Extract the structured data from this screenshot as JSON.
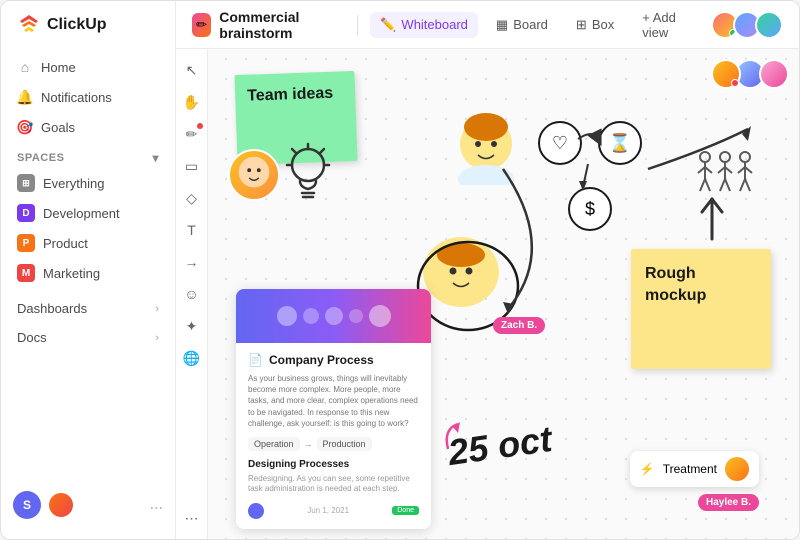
{
  "app": {
    "logo_text": "ClickUp"
  },
  "sidebar": {
    "nav": [
      {
        "id": "home",
        "label": "Home",
        "icon": "⌂"
      },
      {
        "id": "notifications",
        "label": "Notifications",
        "icon": "🔔"
      },
      {
        "id": "goals",
        "label": "Goals",
        "icon": "🎯"
      }
    ],
    "spaces_label": "Spaces",
    "spaces": [
      {
        "id": "everything",
        "label": "Everything",
        "badge": "⊞",
        "color": "#888"
      },
      {
        "id": "development",
        "label": "Development",
        "badge": "D",
        "color": "#7c3aed"
      },
      {
        "id": "product",
        "label": "Product",
        "badge": "P",
        "color": "#f97316"
      },
      {
        "id": "marketing",
        "label": "Marketing",
        "badge": "M",
        "color": "#ef4444"
      }
    ],
    "sections": [
      {
        "id": "dashboards",
        "label": "Dashboards"
      },
      {
        "id": "docs",
        "label": "Docs"
      }
    ],
    "footer": {
      "user_initial": "S",
      "dots": "..."
    }
  },
  "topbar": {
    "breadcrumb_title": "Commercial brainstorm",
    "views": [
      {
        "id": "whiteboard",
        "label": "Whiteboard",
        "icon": "✏️",
        "active": true
      },
      {
        "id": "board",
        "label": "Board",
        "icon": "▦"
      },
      {
        "id": "box",
        "label": "Box",
        "icon": "⊞"
      }
    ],
    "add_view_label": "+ Add view"
  },
  "canvas": {
    "sticky_green_text": "Team ideas",
    "sticky_yellow_text": "Rough mockup",
    "date_label": "25 oct",
    "process_card": {
      "title": "Company Process",
      "desc": "As your business grows, things will inevitably become more complex. More people, more tasks, and more clear, complex operations need to be navigated. In response to this new challenge, ask yourself: is this going to work?",
      "flow_from": "Operation",
      "flow_to": "Production",
      "subtitle": "Designing Processes",
      "subdesc": "Redesigning. As you can see, some repetitive task administration is needed at each step.",
      "date": "Jun 1, 2021",
      "badge": "Done"
    },
    "name_badge1": "Zach B.",
    "name_badge2": "Haylee B.",
    "treatment_label": "Treatment"
  },
  "toolbar_tools": [
    {
      "id": "cursor",
      "icon": "↖",
      "active": false
    },
    {
      "id": "hand",
      "icon": "✋",
      "active": false
    },
    {
      "id": "pencil",
      "icon": "✏",
      "active": false,
      "has_dot": true
    },
    {
      "id": "rectangle",
      "icon": "▭",
      "active": false
    },
    {
      "id": "triangle",
      "icon": "◇",
      "active": false
    },
    {
      "id": "text",
      "icon": "T",
      "active": false
    },
    {
      "id": "arrow",
      "icon": "→",
      "active": false
    },
    {
      "id": "emoji",
      "icon": "☺",
      "active": false
    },
    {
      "id": "sparkle",
      "icon": "✦",
      "active": false
    },
    {
      "id": "globe",
      "icon": "🌐",
      "active": false
    },
    {
      "id": "more",
      "icon": "⋯",
      "active": false
    }
  ]
}
